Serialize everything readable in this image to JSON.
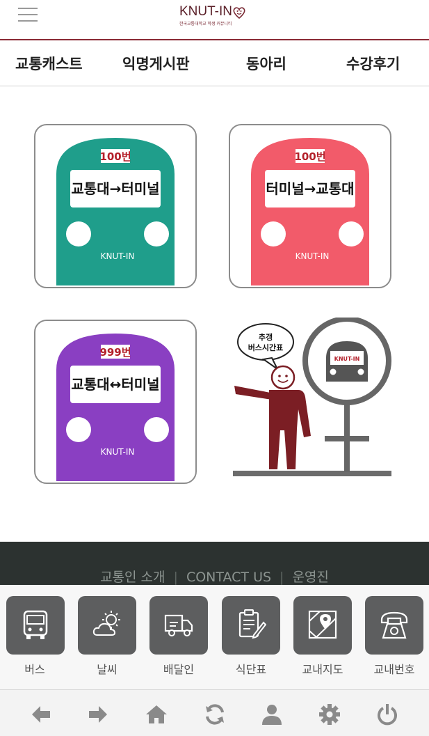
{
  "header": {
    "logo_text": "KNUT-IN",
    "logo_subtitle": "한국교통대학교 학생 커뮤니티"
  },
  "nav": {
    "items": [
      {
        "label": "교통캐스트"
      },
      {
        "label": "익명게시판"
      },
      {
        "label": "동아리"
      },
      {
        "label": "수강후기"
      }
    ]
  },
  "tiles": [
    {
      "route_no": "100번",
      "route": "교통대→터미널",
      "brand": "KNUT-IN",
      "color": "#1f9e8b"
    },
    {
      "route_no": "100번",
      "route": "터미널→교통대",
      "brand": "KNUT-IN",
      "color": "#f25b6a"
    },
    {
      "route_no": "999번",
      "route": "교통대↔터미널",
      "brand": "KNUT-IN",
      "color": "#8a3fc2"
    },
    {
      "speech": [
        "추갱",
        "버스시간표"
      ],
      "stop_brand": "KNUT-IN",
      "person_color": "#7b1e24"
    }
  ],
  "footer": {
    "links": [
      "교통인 소개",
      "CONTACT US",
      "운영진"
    ]
  },
  "quick": {
    "items": [
      {
        "label": "버스",
        "icon": "bus-icon"
      },
      {
        "label": "날씨",
        "icon": "weather-icon"
      },
      {
        "label": "배달인",
        "icon": "delivery-truck-icon"
      },
      {
        "label": "식단표",
        "icon": "menu-notepad-icon"
      },
      {
        "label": "교내지도",
        "icon": "map-icon"
      },
      {
        "label": "교내번호",
        "icon": "telephone-icon"
      }
    ]
  },
  "bottom_bar": {
    "icons": [
      "back-arrow-icon",
      "forward-arrow-icon",
      "home-icon",
      "refresh-icon",
      "user-icon",
      "settings-icon",
      "power-icon"
    ]
  }
}
